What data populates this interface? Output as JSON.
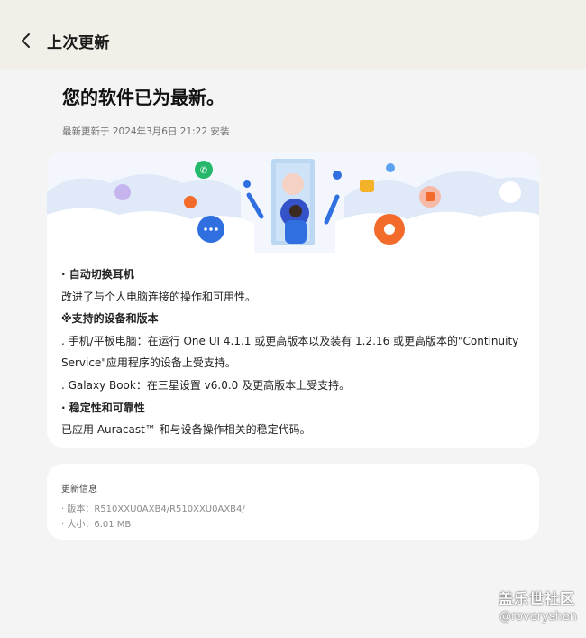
{
  "header": {
    "title": "上次更新",
    "back_icon": "chevron-left-icon"
  },
  "main": {
    "headline": "您的软件已为最新。",
    "last_update": "最新更新于 2024年3月6日 21:22 安装"
  },
  "release_notes": {
    "banner_icons": [
      "phone-icon",
      "chat-icon",
      "folder-icon",
      "flower-icon",
      "settings-icon"
    ],
    "lines": [
      "· 自动切换耳机",
      "改进了与个人电脑连接的操作和可用性。",
      "※支持的设备和版本",
      ". 手机/平板电脑：在运行 One UI 4.1.1 或更高版本以及装有 1.2.16 或更高版本的\"Continuity Service\"应用程序的设备上受支持。",
      ". Galaxy Book：在三星设置 v6.0.0 及更高版本上受支持。",
      "· 稳定性和可靠性",
      "已应用 Auracast™ 和与设备操作相关的稳定代码。"
    ]
  },
  "update_info": {
    "title": "更新信息",
    "version": "· 版本：R510XXU0AXB4/R510XXU0AXB4/",
    "size": "· 大小：6.01 MB"
  },
  "watermark": {
    "brand": "盖乐世社区",
    "handle": "@roveryshen"
  },
  "colors": {
    "topbar_bg": "#f2eee8",
    "page_bg": "#f4f4f4",
    "card_bg": "#ffffff",
    "accent_blue": "#2f6fe0",
    "accent_orange": "#f36b2a"
  }
}
